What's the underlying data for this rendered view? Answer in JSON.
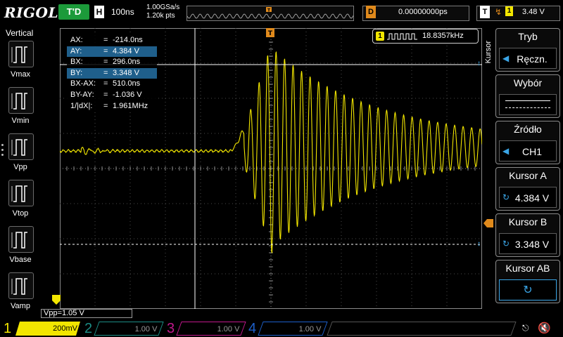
{
  "colors": {
    "ch1": "#f2e600",
    "ch2": "#1c8d85",
    "ch3": "#c2188c",
    "ch4": "#1d5fc9",
    "run_green": "#1c9a3a",
    "trigger_orange": "#e08a1c",
    "highlight_blue": "#1f5f8b"
  },
  "topbar": {
    "logo": "RIGOL",
    "run_status": "T'D",
    "timebase_key": "H",
    "timebase_value": "100ns",
    "sample_rate": "1.00GSa/s",
    "memory_depth": "1.20k pts",
    "delay_key": "D",
    "delay_value": "0.00000000ps",
    "trigger_key": "T",
    "trigger_edge_icon": "rising-edge-icon",
    "trigger_channel": "1",
    "trigger_level": "3.48 V"
  },
  "left_panel": {
    "title": "Vertical",
    "measurements": [
      {
        "label": "Vmax",
        "icon": "vmax-icon"
      },
      {
        "label": "Vmin",
        "icon": "vmin-icon"
      },
      {
        "label": "Vpp",
        "icon": "vpp-icon"
      },
      {
        "label": "Vtop",
        "icon": "vtop-icon"
      },
      {
        "label": "Vbase",
        "icon": "vbase-icon"
      },
      {
        "label": "Vamp",
        "icon": "vamp-icon"
      }
    ]
  },
  "cursor_readout": [
    {
      "name": "AX:",
      "eq": "=",
      "value": "-214.0ns",
      "highlight": false
    },
    {
      "name": "AY:",
      "eq": "=",
      "value": "4.384 V",
      "highlight": true
    },
    {
      "name": "BX:",
      "eq": "=",
      "value": "296.0ns",
      "highlight": false
    },
    {
      "name": "BY:",
      "eq": "=",
      "value": "3.348 V",
      "highlight": true
    },
    {
      "name": "BX-AX:",
      "eq": "=",
      "value": "510.0ns",
      "highlight": false
    },
    {
      "name": "BY-AY:",
      "eq": "=",
      "value": "-1.036 V",
      "highlight": false
    },
    {
      "name": "1/|dX|:",
      "eq": "=",
      "value": "1.961MHz",
      "highlight": false
    }
  ],
  "frequency_counter": {
    "channel": "1",
    "value": "18.8357kHz"
  },
  "right_menu": {
    "tab_label": "Kursor",
    "buttons": [
      {
        "title": "Tryb",
        "value": "Ręczn."
      },
      {
        "title": "Wybór",
        "value": ""
      },
      {
        "title": "Źródło",
        "value": "CH1"
      },
      {
        "title": "Kursor A",
        "value": "4.384 V"
      },
      {
        "title": "Kursor B",
        "value": "3.348 V"
      },
      {
        "title": "Kursor AB",
        "value": ""
      }
    ]
  },
  "measurement_readout": "Vpp=1.05 V",
  "bottom_bar": {
    "channels": [
      {
        "num": "1",
        "scale": "200mV"
      },
      {
        "num": "2",
        "scale": "1.00 V"
      },
      {
        "num": "3",
        "scale": "1.00 V"
      },
      {
        "num": "4",
        "scale": "1.00 V"
      }
    ],
    "usb_icon": "usb-icon",
    "mute_icon": "speaker-mute-icon"
  }
}
